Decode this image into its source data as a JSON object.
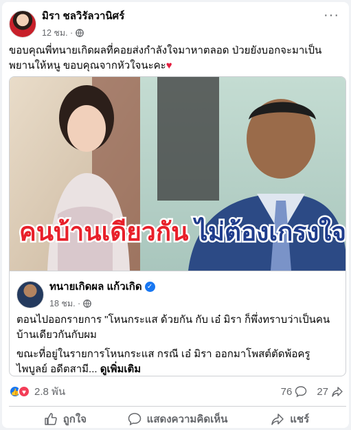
{
  "post": {
    "author": "มิรา ชลวิรัลวานิศร์",
    "time": "12 ชม. ·",
    "text": "ขอบคุณพี่ทนายเกิดผลที่คอยส่งกำลังใจมาหาตลอด ป่วยยังบอกจะมาเป็นพยานให้หนู ขอบคุณจากหัวใจนะคะ",
    "emoji": "♥"
  },
  "shared": {
    "overlay_text_left": "คนบ้านเดียวกัน",
    "overlay_text_right": "ไม่ต้องเกรงใจ",
    "author": "ทนายเกิดผล แก้วเกิด",
    "time": "18 ชม. ·",
    "paragraph1": "ตอนไปออกรายการ \"โหนกระแส ด้วยกัน กับ เอ๋ มิรา ก็พึ่งทราบว่าเป็นคนบ้านเดียวกันกับผม",
    "paragraph2": "ขณะที่อยู่ในรายการโหนกระแส กรณี เอ๋ มิรา ออกมาโพสต์ตัดพ้อครูไพบูลย์ อดีตสามี...",
    "see_more": "ดูเพิ่มเติม"
  },
  "stats": {
    "reactions": "2.8 พัน",
    "comments": "76",
    "shares": "27"
  },
  "actions": {
    "like": "ถูกใจ",
    "comment": "แสดงความคิดเห็น",
    "share": "แชร์"
  },
  "icons": [
    "globe-icon",
    "more-icon",
    "verified-icon",
    "like-reaction-icon",
    "love-reaction-icon",
    "comment-icon",
    "share-icon",
    "like-icon"
  ],
  "colors": {
    "brand_blue": "#1877f2",
    "overlay_red": "#e8202a",
    "overlay_blue": "#1f3c8c",
    "love_red": "#f33e58"
  }
}
